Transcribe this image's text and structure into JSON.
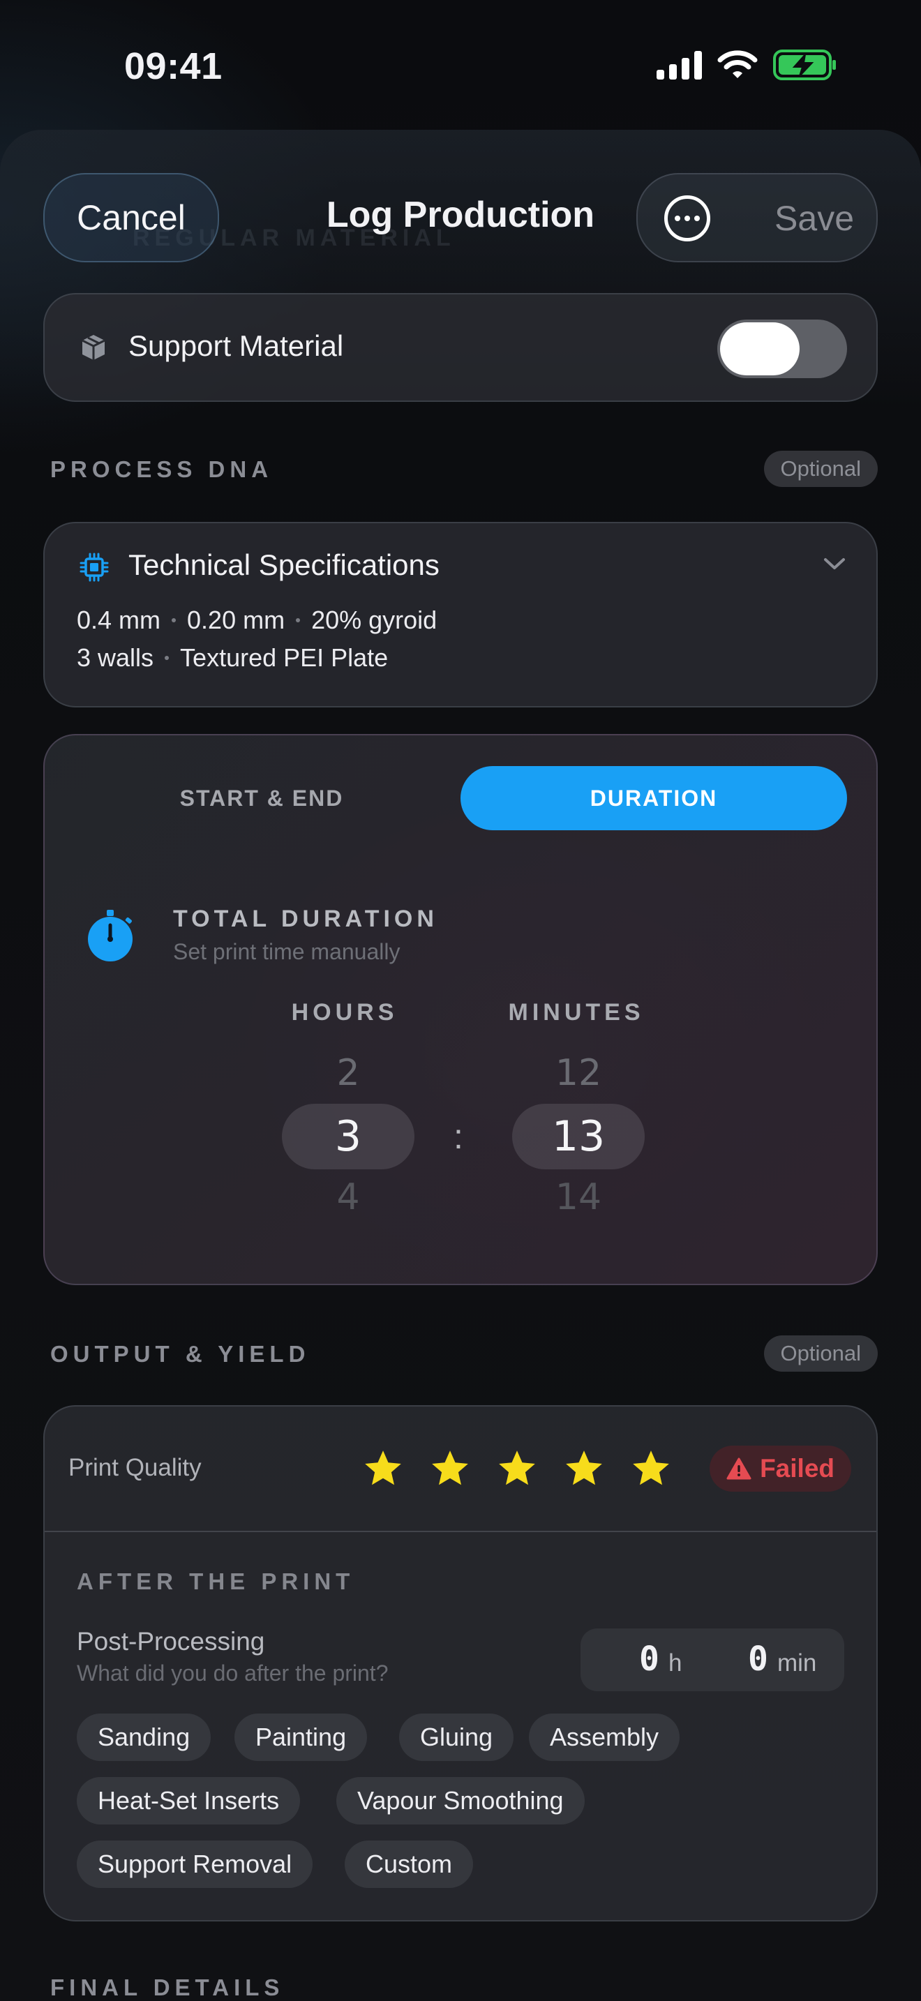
{
  "status_bar": {
    "time": "09:41"
  },
  "header": {
    "ghost_text": "REGULAR MATERIAL",
    "cancel_label": "Cancel",
    "title": "Log Production",
    "save_label": "Save"
  },
  "support_material": {
    "label": "Support Material",
    "enabled": true
  },
  "process_dna": {
    "section_title": "PROCESS DNA",
    "badge": "Optional",
    "card": {
      "title": "Technical Specifications",
      "specs_line1": [
        "0.4 mm",
        "0.20 mm",
        "20% gyroid"
      ],
      "specs_line2": [
        "3 walls",
        "Textured PEI Plate"
      ]
    }
  },
  "time_card": {
    "tabs": [
      {
        "label": "START & END",
        "selected": false
      },
      {
        "label": "DURATION",
        "selected": true
      }
    ],
    "title": "TOTAL DURATION",
    "subtitle": "Set print time manually",
    "hours": {
      "label": "HOURS",
      "prev": "2",
      "value": "3",
      "next": "4"
    },
    "minutes": {
      "label": "MINUTES",
      "prev": "12",
      "value": "13",
      "next": "14"
    },
    "separator": ":"
  },
  "output_yield": {
    "section_title": "OUTPUT & YIELD",
    "badge": "Optional",
    "print_quality": {
      "label": "Print Quality",
      "rating": 5,
      "max": 5,
      "failed_label": "Failed"
    },
    "after_print": {
      "title": "AFTER THE PRINT",
      "post_processing_label": "Post-Processing",
      "post_processing_hint": "What did you do after the print?",
      "hours_value": "0",
      "hours_unit": "h",
      "minutes_value": "0",
      "minutes_unit": "min",
      "chips": [
        "Sanding",
        "Painting",
        "Gluing",
        "Assembly",
        "Heat-Set Inserts",
        "Vapour Smoothing",
        "Support Removal",
        "Custom"
      ]
    }
  },
  "final_details": {
    "section_title": "FINAL DETAILS"
  },
  "colors": {
    "accent": "#19a0f5",
    "star": "#f7dc1b",
    "failed": "#e54b52",
    "battery": "#35c759"
  }
}
